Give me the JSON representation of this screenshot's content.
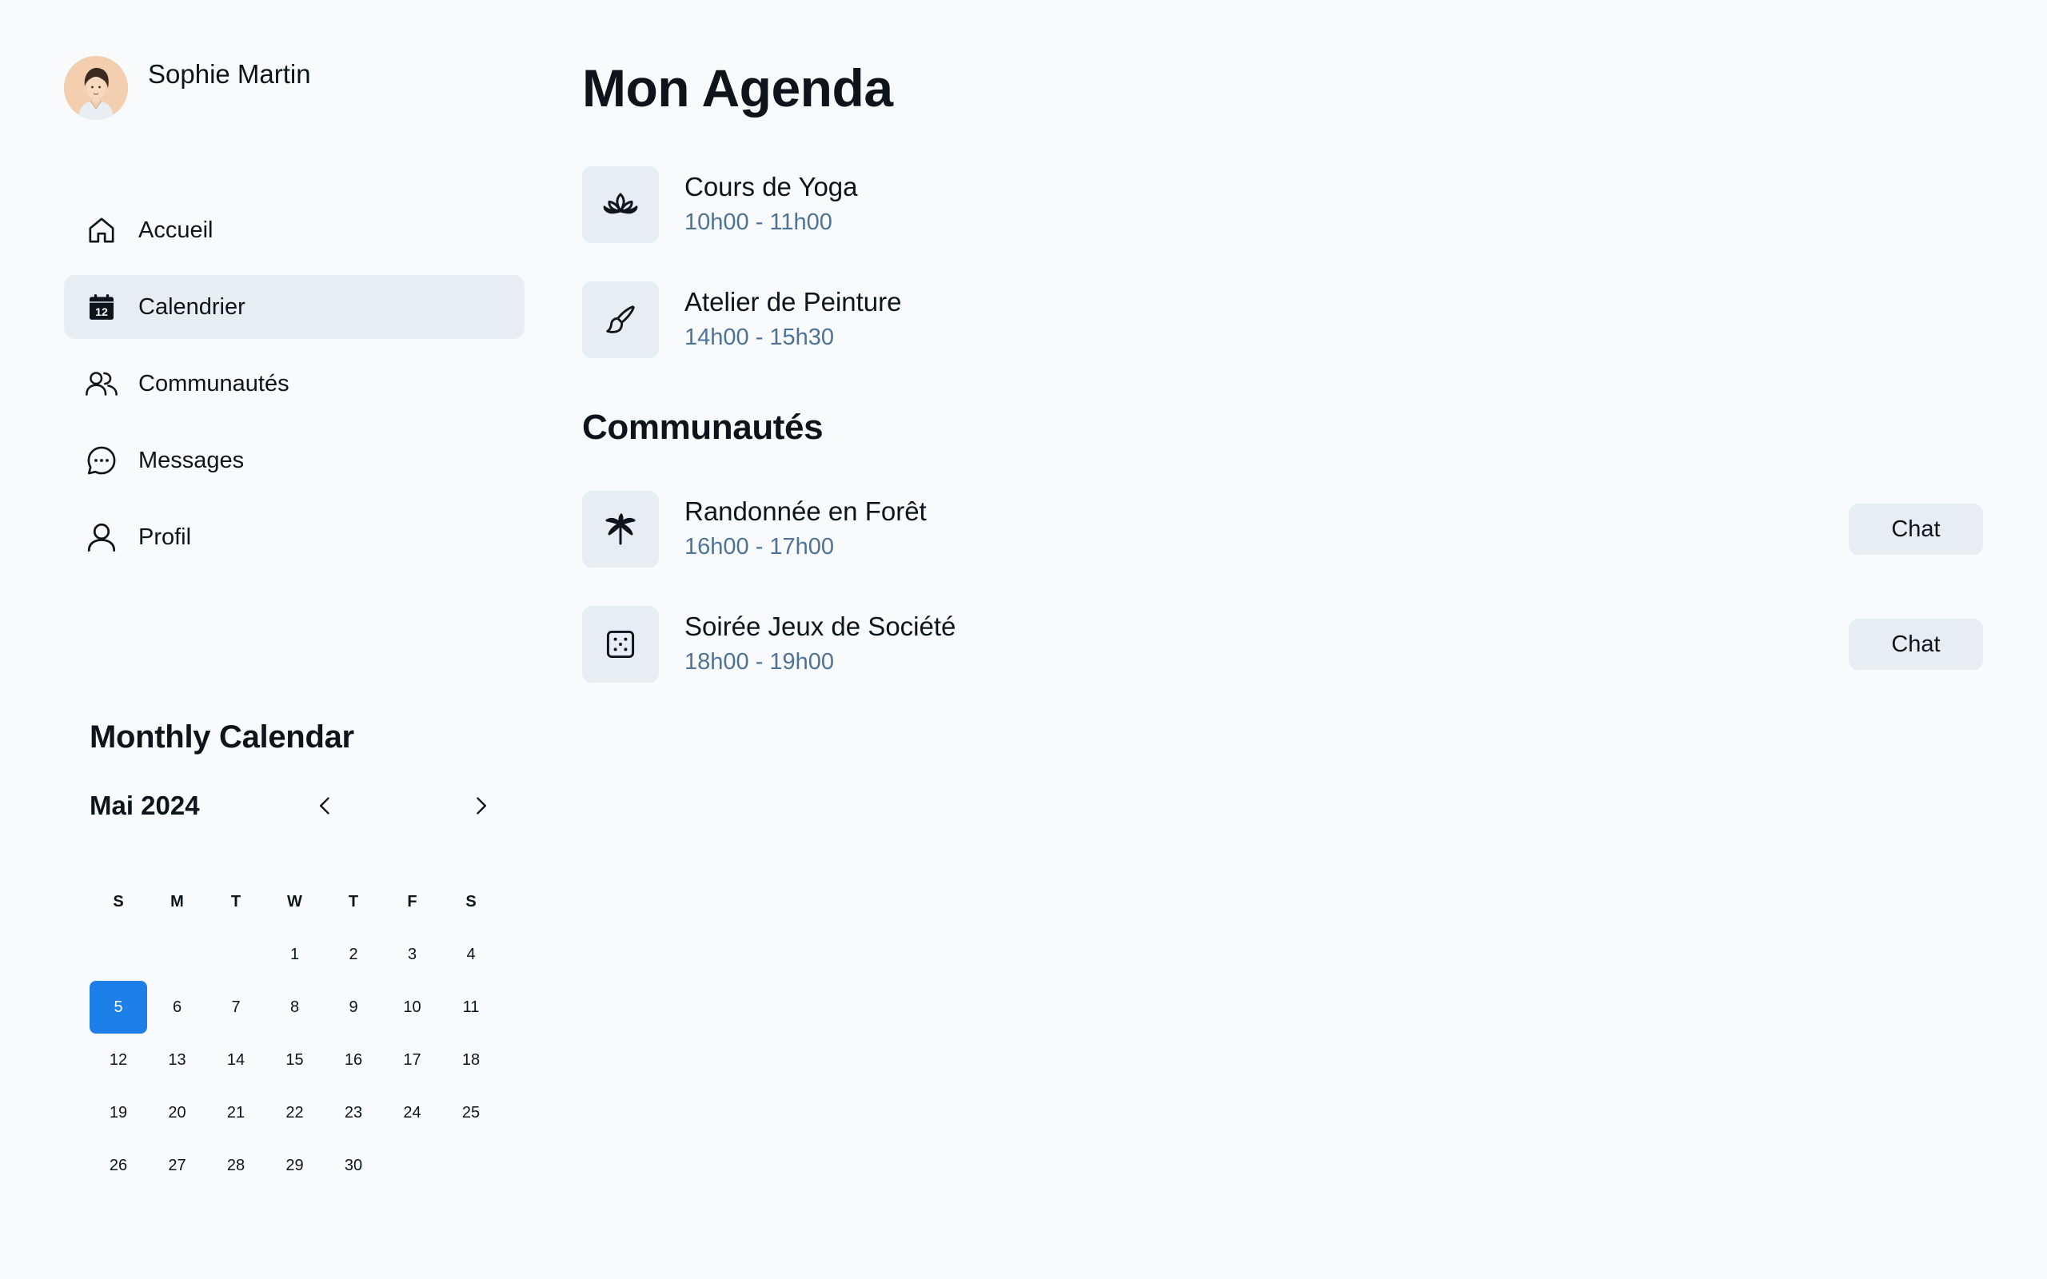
{
  "user": {
    "name": "Sophie Martin"
  },
  "sidebar": {
    "items": [
      {
        "label": "Accueil",
        "icon": "home-icon",
        "active": false
      },
      {
        "label": "Calendrier",
        "icon": "calendar-icon",
        "active": true,
        "icon_badge": "12"
      },
      {
        "label": "Communautés",
        "icon": "users-icon",
        "active": false
      },
      {
        "label": "Messages",
        "icon": "chat-bubble-icon",
        "active": false
      },
      {
        "label": "Profil",
        "icon": "user-icon",
        "active": false
      }
    ]
  },
  "calendar": {
    "title": "Monthly Calendar",
    "month_label": "Mai 2024",
    "weekdays": [
      "S",
      "M",
      "T",
      "W",
      "T",
      "F",
      "S"
    ],
    "first_weekday_index": 3,
    "days": [
      "1",
      "2",
      "3",
      "4",
      "5",
      "6",
      "7",
      "8",
      "9",
      "10",
      "11",
      "12",
      "13",
      "14",
      "15",
      "16",
      "17",
      "18",
      "19",
      "20",
      "21",
      "22",
      "23",
      "24",
      "25",
      "26",
      "27",
      "28",
      "29",
      "30"
    ],
    "selected_day": "5",
    "accent_color": "#1d80e8"
  },
  "agenda": {
    "title": "Mon Agenda",
    "events": [
      {
        "name": "Cours de Yoga",
        "time": "10h00 - 11h00",
        "icon": "lotus-icon"
      },
      {
        "name": "Atelier de Peinture",
        "time": "14h00 - 15h30",
        "icon": "paintbrush-icon"
      }
    ]
  },
  "communities": {
    "title": "Communautés",
    "events": [
      {
        "name": "Randonnée en Forêt",
        "time": "16h00 - 17h00",
        "icon": "palm-tree-icon",
        "button": "Chat"
      },
      {
        "name": "Soirée Jeux de Société",
        "time": "18h00 - 19h00",
        "icon": "dice-icon",
        "button": "Chat"
      }
    ]
  },
  "colors": {
    "background": "#f8fafc",
    "surface": "#e8edf3",
    "text": "#0d141c",
    "muted_text": "#4f7396",
    "accent": "#1d80e8"
  }
}
